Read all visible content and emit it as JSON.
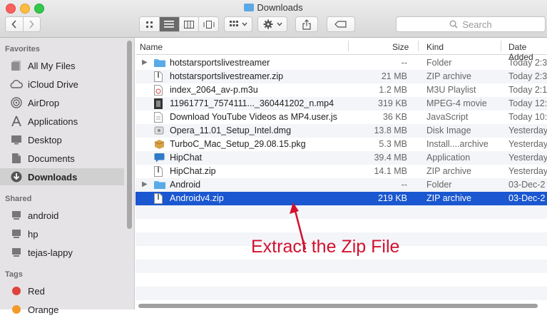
{
  "window": {
    "title": "Downloads"
  },
  "toolbar": {
    "search_placeholder": "Search"
  },
  "sidebar": {
    "favorites_heading": "Favorites",
    "favorites": [
      {
        "label": "All My Files",
        "icon": "all-files-icon"
      },
      {
        "label": "iCloud Drive",
        "icon": "cloud-icon"
      },
      {
        "label": "AirDrop",
        "icon": "airdrop-icon"
      },
      {
        "label": "Applications",
        "icon": "applications-icon"
      },
      {
        "label": "Desktop",
        "icon": "desktop-icon"
      },
      {
        "label": "Documents",
        "icon": "documents-icon"
      },
      {
        "label": "Downloads",
        "icon": "downloads-icon",
        "selected": true
      }
    ],
    "shared_heading": "Shared",
    "shared": [
      {
        "label": "android",
        "icon": "computer-icon"
      },
      {
        "label": "hp",
        "icon": "computer-icon"
      },
      {
        "label": "tejas-lappy",
        "icon": "computer-icon"
      }
    ],
    "tags_heading": "Tags",
    "tags": [
      {
        "label": "Red",
        "color": "#e0423c"
      },
      {
        "label": "Orange",
        "color": "#f39a2b"
      }
    ]
  },
  "columns": {
    "name": "Name",
    "size": "Size",
    "kind": "Kind",
    "date": "Date Added"
  },
  "files": [
    {
      "name": "hotstarsportslivestreamer",
      "size": "--",
      "kind": "Folder",
      "date": "Today 2:3",
      "icon": "folder-icon",
      "expandable": true
    },
    {
      "name": "hotstarsportslivestreamer.zip",
      "size": "21 MB",
      "kind": "ZIP archive",
      "date": "Today 2:3",
      "icon": "zip-icon"
    },
    {
      "name": "index_2064_av-p.m3u",
      "size": "1.2 MB",
      "kind": "M3U Playlist",
      "date": "Today 2:1",
      "icon": "playlist-icon"
    },
    {
      "name": "11961771_7574111..._360441202_n.mp4",
      "size": "319 KB",
      "kind": "MPEG-4 movie",
      "date": "Today 12:",
      "icon": "movie-icon"
    },
    {
      "name": "Download YouTube Videos as MP4.user.js",
      "size": "36 KB",
      "kind": "JavaScript",
      "date": "Today 10:",
      "icon": "script-icon"
    },
    {
      "name": "Opera_11.01_Setup_Intel.dmg",
      "size": "13.8 MB",
      "kind": "Disk Image",
      "date": "Yesterday",
      "icon": "disk-image-icon"
    },
    {
      "name": "TurboC_Mac_Setup_29.08.15.pkg",
      "size": "5.3 MB",
      "kind": "Install....archive",
      "date": "Yesterday",
      "icon": "package-icon"
    },
    {
      "name": "HipChat",
      "size": "39.4 MB",
      "kind": "Application",
      "date": "Yesterday",
      "icon": "hipchat-icon"
    },
    {
      "name": "HipChat.zip",
      "size": "14.1 MB",
      "kind": "ZIP archive",
      "date": "Yesterday",
      "icon": "zip-icon"
    },
    {
      "name": "Android",
      "size": "--",
      "kind": "Folder",
      "date": "03-Dec-2",
      "icon": "folder-icon",
      "expandable": true
    },
    {
      "name": "Androidv4.zip",
      "size": "219 KB",
      "kind": "ZIP archive",
      "date": "03-Dec-2",
      "icon": "zip-icon",
      "selected": true
    }
  ],
  "annotation": {
    "text": "Extract the Zip File",
    "color": "#d2102f"
  }
}
